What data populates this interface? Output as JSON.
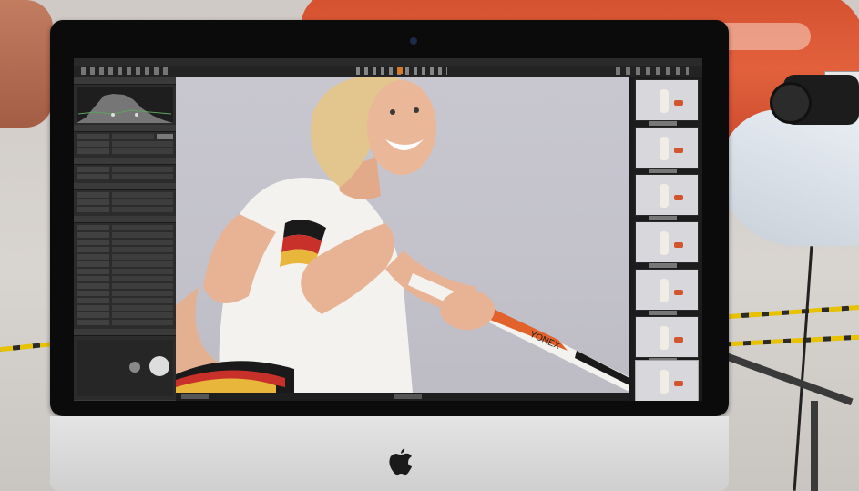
{
  "scene": {
    "car_color": "#d4502f",
    "car_plate": "",
    "floor_stripe_color": "#e6c200"
  },
  "monitor": {
    "logo": "apple-logo",
    "bezel_color": "#0b0b0b",
    "chin_color": "#d9d9d9"
  },
  "app": {
    "window_title": "",
    "accent_color": "#d87a2c",
    "left_panel_sections": 7,
    "filmstrip_count": 7,
    "photo_background": "#c6c5cd"
  },
  "photo": {
    "subject_colors": {
      "shirt": "#f4f2ee",
      "hair": "#e2c68e",
      "skin": "#e7b394",
      "racket_accent": "#e2622b",
      "stripe_red": "#c8302a",
      "stripe_gold": "#e8b63a",
      "stripe_black": "#1a1a1a"
    },
    "racket_brand": "YONEX"
  }
}
